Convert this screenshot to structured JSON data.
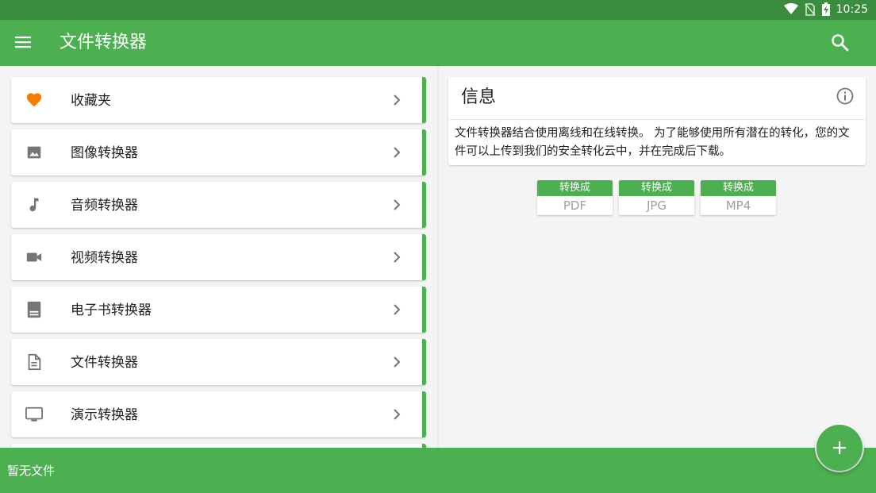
{
  "status_bar": {
    "time": "10:25",
    "icons": [
      "wifi-icon",
      "no-sim-icon",
      "battery-charging-icon"
    ]
  },
  "app_bar": {
    "title": "文件转换器",
    "menu_icon": "menu-icon",
    "search_icon": "search-icon"
  },
  "categories": [
    {
      "label": "收藏夹",
      "icon": "heart-icon",
      "icon_color": "#f57c00"
    },
    {
      "label": "图像转换器",
      "icon": "image-icon",
      "icon_color": "#757575"
    },
    {
      "label": "音频转换器",
      "icon": "music-note-icon",
      "icon_color": "#757575"
    },
    {
      "label": "视频转换器",
      "icon": "video-camera-icon",
      "icon_color": "#757575"
    },
    {
      "label": "电子书转换器",
      "icon": "book-icon",
      "icon_color": "#757575"
    },
    {
      "label": "文件转换器",
      "icon": "document-icon",
      "icon_color": "#757575"
    },
    {
      "label": "演示转换器",
      "icon": "monitor-icon",
      "icon_color": "#757575"
    }
  ],
  "info": {
    "title": "信息",
    "text": "文件转换器结合使用离线和在线转换。 为了能够使用所有潜在的转化，您的文件可以上传到我们的安全转化云中，并在完成后下载。"
  },
  "convert_buttons": [
    {
      "caption": "转换成",
      "format": "PDF"
    },
    {
      "caption": "转换成",
      "format": "JPG"
    },
    {
      "caption": "转换成",
      "format": "MP4"
    }
  ],
  "bottom_bar": {
    "text": "暂无文件"
  },
  "colors": {
    "primary": "#4caf50",
    "primary_dark": "#3b8c3e",
    "accent": "#f57c00",
    "icon_grey": "#757575"
  }
}
